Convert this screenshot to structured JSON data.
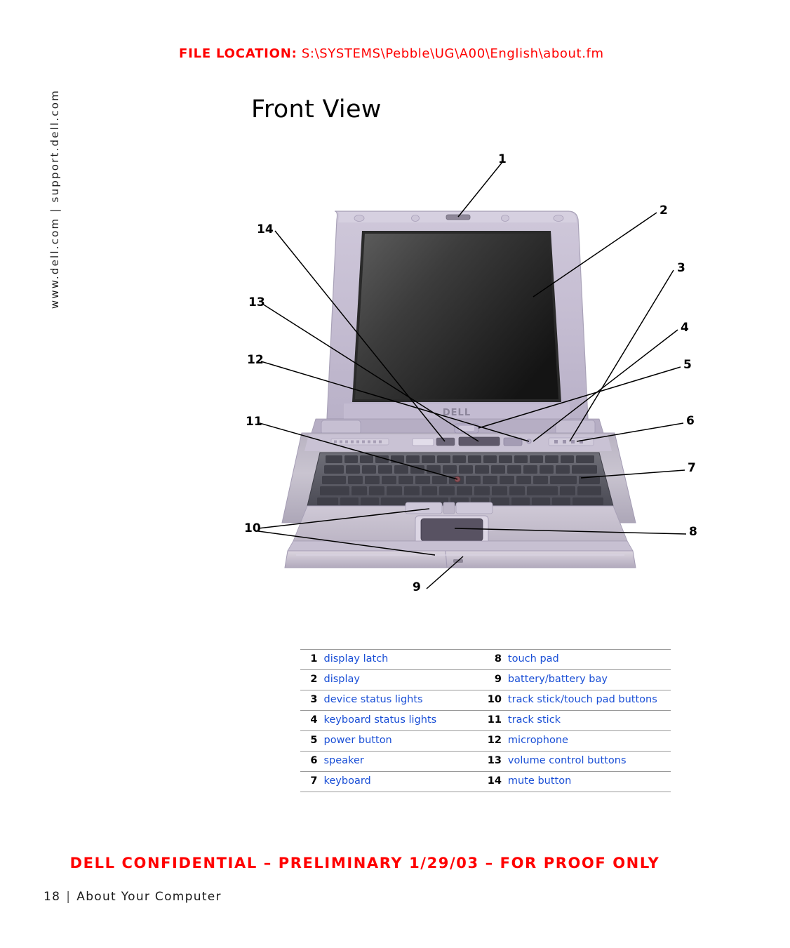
{
  "header": {
    "file_location_label": "FILE LOCATION:",
    "file_location_path": "S:\\SYSTEMS\\Pebble\\UG\\A00\\English\\about.fm",
    "color": "#ff0000"
  },
  "sidebar": {
    "url_text": "www.dell.com | support.dell.com"
  },
  "main": {
    "title": "Front View"
  },
  "figure": {
    "name": "dell-laptop-front-view-illustration",
    "callouts": [
      {
        "number": "1",
        "side": "top"
      },
      {
        "number": "2",
        "side": "right"
      },
      {
        "number": "3",
        "side": "right"
      },
      {
        "number": "4",
        "side": "right"
      },
      {
        "number": "5",
        "side": "right"
      },
      {
        "number": "6",
        "side": "right"
      },
      {
        "number": "7",
        "side": "right"
      },
      {
        "number": "8",
        "side": "right"
      },
      {
        "number": "9",
        "side": "bottom"
      },
      {
        "number": "10",
        "side": "left"
      },
      {
        "number": "11",
        "side": "left"
      },
      {
        "number": "12",
        "side": "left"
      },
      {
        "number": "13",
        "side": "left"
      },
      {
        "number": "14",
        "side": "left"
      }
    ]
  },
  "legend": {
    "rows": [
      {
        "left_num": "1",
        "left_label": "display latch",
        "right_num": "8",
        "right_label": "touch pad"
      },
      {
        "left_num": "2",
        "left_label": "display",
        "right_num": "9",
        "right_label": "battery/battery bay"
      },
      {
        "left_num": "3",
        "left_label": "device status lights",
        "right_num": "10",
        "right_label": "track stick/touch pad buttons"
      },
      {
        "left_num": "4",
        "left_label": "keyboard status lights",
        "right_num": "11",
        "right_label": "track stick"
      },
      {
        "left_num": "5",
        "left_label": "power button",
        "right_num": "12",
        "right_label": "microphone"
      },
      {
        "left_num": "6",
        "left_label": "speaker",
        "right_num": "13",
        "right_label": "volume control buttons"
      },
      {
        "left_num": "7",
        "left_label": "keyboard",
        "right_num": "14",
        "right_label": "mute button"
      }
    ],
    "label_color": "#1a4fd6"
  },
  "footer": {
    "confidential_notice": "DELL CONFIDENTIAL – PRELIMINARY 1/29/03 – FOR PROOF ONLY",
    "page_number": "18",
    "separator": "|",
    "chapter_title": "About Your Computer"
  }
}
